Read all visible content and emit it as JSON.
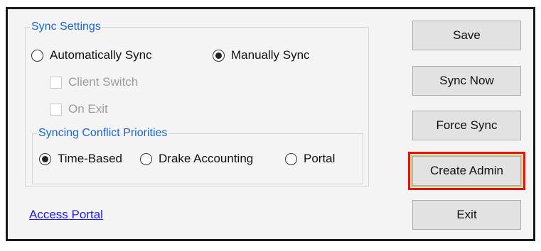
{
  "sync_settings": {
    "title": "Sync Settings",
    "mode_options": [
      {
        "label": "Automatically Sync",
        "selected": false
      },
      {
        "label": "Manually Sync",
        "selected": true
      }
    ],
    "checkboxes": [
      {
        "label": "Client Switch",
        "checked": false,
        "enabled": false
      },
      {
        "label": "On Exit",
        "checked": false,
        "enabled": false
      }
    ],
    "conflict": {
      "title": "Syncing Conflict Priorities",
      "options": [
        {
          "label": "Time-Based",
          "selected": true
        },
        {
          "label": "Drake Accounting",
          "selected": false
        },
        {
          "label": "Portal",
          "selected": false
        }
      ]
    }
  },
  "access_portal_link": "Access Portal",
  "buttons": {
    "save": "Save",
    "sync_now": "Sync Now",
    "force_sync": "Force Sync",
    "create_admin": "Create Admin",
    "exit": "Exit"
  },
  "highlight": {
    "target": "create_admin",
    "color": "#e01515"
  }
}
